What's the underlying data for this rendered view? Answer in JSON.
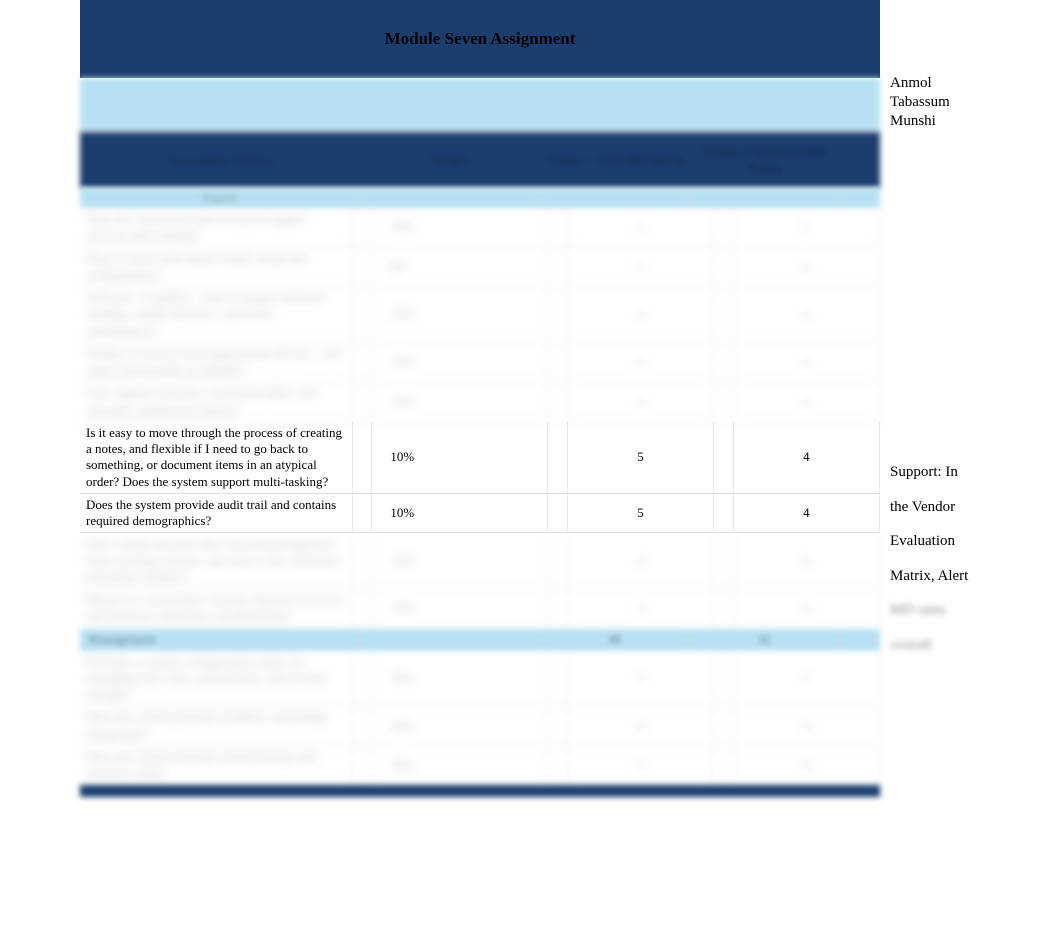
{
  "title": "Module Seven Assignment",
  "author": {
    "line1": "Anmol",
    "line2": "Tabassum",
    "line3": "Munshi"
  },
  "headers": {
    "criteria": "Assessment Criteria",
    "weight": "Weight",
    "vendor1": "Vendor 1 Alert MD Rating",
    "vendor2": "Vendor 2 Nextech EMR Rating"
  },
  "subheader": {
    "section_a": "Support"
  },
  "rows_blurred_top": [
    {
      "criteria": "Does the system provide technical support services and training?",
      "weight": "10%",
      "v1": "5",
      "v2": "5"
    },
    {
      "criteria": "Does it assist with initial vendor setup and configuration?",
      "weight": "8%",
      "v1": "5",
      "v2": "4"
    },
    {
      "criteria": "Software / Usability – does it require minimal training, simple interface, and lower maintenance?",
      "weight": "12%",
      "v1": "4",
      "v2": "4"
    },
    {
      "criteria": "Outline of service level agreements (SLA) — are repair turnarounds acceptable?",
      "weight": "10%",
      "v1": "5",
      "v2": "4"
    },
    {
      "criteria": "User support structure, escalation paths, and customer satisfaction history?",
      "weight": "10%",
      "v1": "4",
      "v2": "4"
    }
  ],
  "rows_crisp": [
    {
      "criteria": "Is it easy to move through the process of creating a notes, and flexible if I need to go back to something, or document items in an atypical order? Does the system support multi-tasking?",
      "weight": "10%",
      "v1": "5",
      "v2": "4"
    },
    {
      "criteria": "Does the system provide audit trail and contains required demographics?",
      "weight": "10%",
      "v1": "5",
      "v2": "4"
    }
  ],
  "rows_blurred_mid": [
    {
      "criteria": "Does vendor provide data conversion/migration from existing systems, and what is the estimated downtime window?",
      "weight": "10%",
      "v1": "4",
      "v2": "4"
    },
    {
      "criteria": "Hosted vs. on-premise: backup, disaster-recovery, and business continuity considerations?",
      "weight": "10%",
      "v1": "5",
      "v2": "4"
    }
  ],
  "section_label": "Management",
  "section_totals": {
    "v1": "48",
    "v2": "42"
  },
  "rows_blurred_bottom": [
    {
      "criteria": "Provides a system configuration utility for managing user roles, permissions, and security settings?",
      "weight": "10%",
      "v1": "5",
      "v2": "5"
    },
    {
      "criteria": "Does the system provide workflow and billing integration?",
      "weight": "10%",
      "v1": "4",
      "v2": "4"
    },
    {
      "criteria": "Does the system provide system backup and recovery tools?",
      "weight": "10%",
      "v1": "5",
      "v2": "4"
    }
  ],
  "support_note": {
    "l1": "Support:   In",
    "l2": "the Vendor",
    "l3": "Evaluation",
    "l4": "Matrix, Alert",
    "l5": "MD rates",
    "l6": "overall"
  }
}
